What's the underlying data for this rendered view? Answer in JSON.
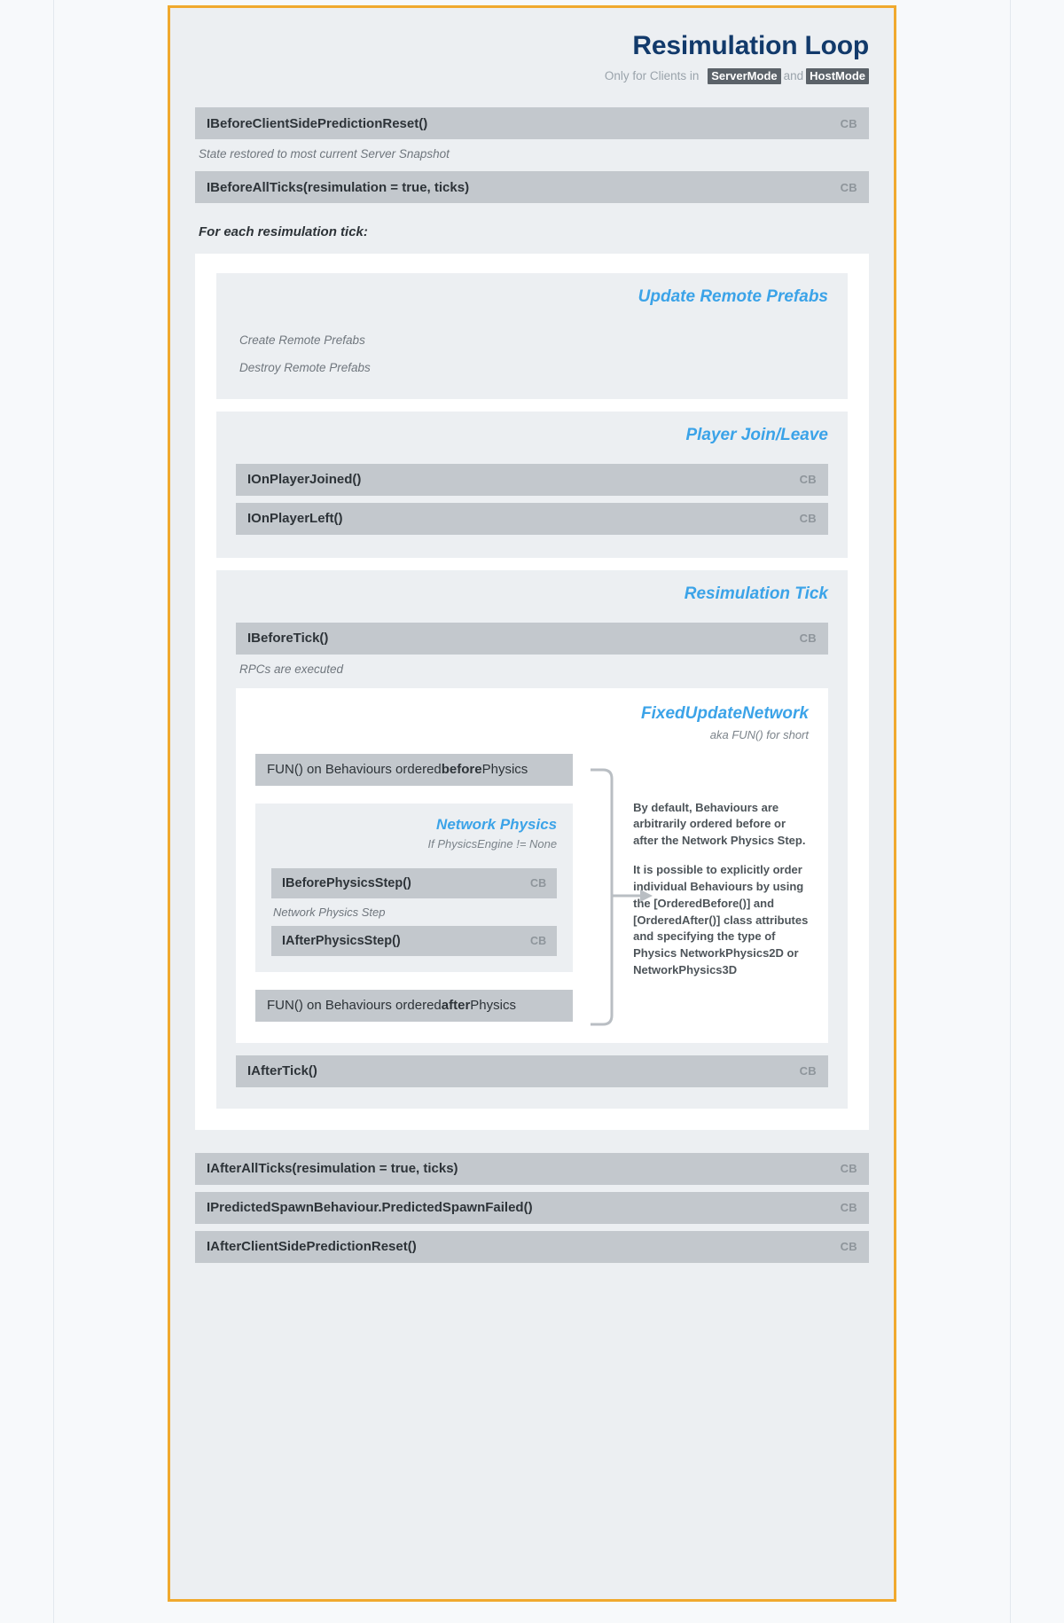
{
  "header": {
    "title": "Resimulation Loop",
    "subtitle_prefix": "Only for Clients in",
    "mode_a": "ServerMode",
    "subtitle_join": "and",
    "mode_b": "HostMode"
  },
  "top": {
    "callbacks": [
      {
        "label": "IBeforeClientSidePredictionReset()",
        "tag": "CB"
      },
      {
        "label": "IBeforeAllTicks(resimulation = true, ticks)",
        "tag": "CB"
      }
    ],
    "note_after_first": "State restored to most current Server Snapshot",
    "section_lead": "For each resimulation tick:"
  },
  "remote_prefabs": {
    "heading": "Update Remote Prefabs",
    "items": [
      "Create Remote Prefabs",
      "Destroy Remote Prefabs"
    ]
  },
  "player_join_leave": {
    "heading": "Player Join/Leave",
    "callbacks": [
      {
        "label": "IOnPlayerJoined()",
        "tag": "CB"
      },
      {
        "label": "IOnPlayerLeft()",
        "tag": "CB"
      }
    ]
  },
  "resimulation_tick": {
    "heading": "Resimulation Tick",
    "before_tick": {
      "label": "IBeforeTick()",
      "tag": "CB"
    },
    "rpc_note": "RPCs are executed",
    "after_tick": {
      "label": "IAfterTick()",
      "tag": "CB"
    },
    "fun": {
      "heading": "FixedUpdateNetwork",
      "subheading": "aka FUN() for short",
      "bar_before_prefix": "FUN() on Behaviours ordered ",
      "bar_before_bold": "before",
      "bar_before_suffix": " Physics",
      "bar_after_prefix": "FUN() on Behaviours ordered ",
      "bar_after_bold": "after",
      "bar_after_suffix": " Physics",
      "physics": {
        "heading": "Network Physics",
        "subheading": "If PhysicsEngine != None",
        "before_step": {
          "label": "IBeforePhysicsStep()",
          "tag": "CB"
        },
        "step_note": "Network Physics Step",
        "after_step": {
          "label": "IAfterPhysicsStep()",
          "tag": "CB"
        }
      },
      "side_note_p1": "By default, Behaviours are arbitrarily ordered before or after the Network Physics Step.",
      "side_note_p2": "It is possible to explicitly order individual Behaviours by using the [OrderedBefore()] and [OrderedAfter()] class attributes and specifying the type of Physics NetworkPhysics2D or NetworkPhysics3D"
    }
  },
  "footer": {
    "callbacks": [
      {
        "label": "IAfterAllTicks(resimulation = true, ticks)",
        "tag": "CB"
      },
      {
        "label": "IPredictedSpawnBehaviour.PredictedSpawnFailed()",
        "tag": "CB"
      },
      {
        "label": "IAfterClientSidePredictionReset()",
        "tag": "CB"
      }
    ]
  },
  "colors": {
    "accent_border": "#f0a92e",
    "title": "#123a6b",
    "section_heading": "#3ba3e8",
    "bar_bg": "#c3c8cd",
    "panel_bg": "#eceff2",
    "chip_bg": "#5b6269"
  }
}
